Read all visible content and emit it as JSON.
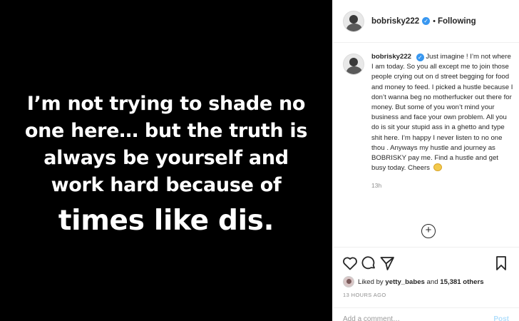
{
  "media": {
    "lines": [
      "I’m not trying to shade no",
      "one here… but the truth is",
      "always be yourself and",
      "work hard because of"
    ],
    "big_line": "times like dis."
  },
  "header": {
    "username": "bobrisky222",
    "follow_state": "Following"
  },
  "caption": {
    "username": "bobrisky222",
    "text": "Just imagine ! I’m not where I am today. So you all except me to join those people crying out on d street begging for food and money to feed. I picked a hustle because I don’t wanna beg no motherfucker out there for money. But some of you won’t mind your business and face your own problem. All you do is sit your stupid ass in a ghetto and type shit here. I’m happy I never listen to no one thou . Anyways my hustle and journey as BOBRISKY pay me. Find a hustle and get busy today. Cheers",
    "age": "13h"
  },
  "likes": {
    "prefix": "Liked by",
    "liker": "yetty_babes",
    "middle": "and",
    "others": "15,381 others"
  },
  "timestamp": "13 HOURS AGO",
  "comment": {
    "placeholder": "Add a comment…",
    "post_label": "Post"
  },
  "icons": {
    "verified": "verified-badge-icon",
    "like": "heart-icon",
    "comment": "comment-bubble-icon",
    "share": "paper-plane-icon",
    "save": "bookmark-icon",
    "load_more": "plus-circle-icon",
    "emoji": "grinning-sweat-emoji"
  },
  "colors": {
    "media_bg": "#000000",
    "verified_blue": "#3897f0",
    "muted_text": "#8e8e8e",
    "post_button": "#b2dffc"
  }
}
